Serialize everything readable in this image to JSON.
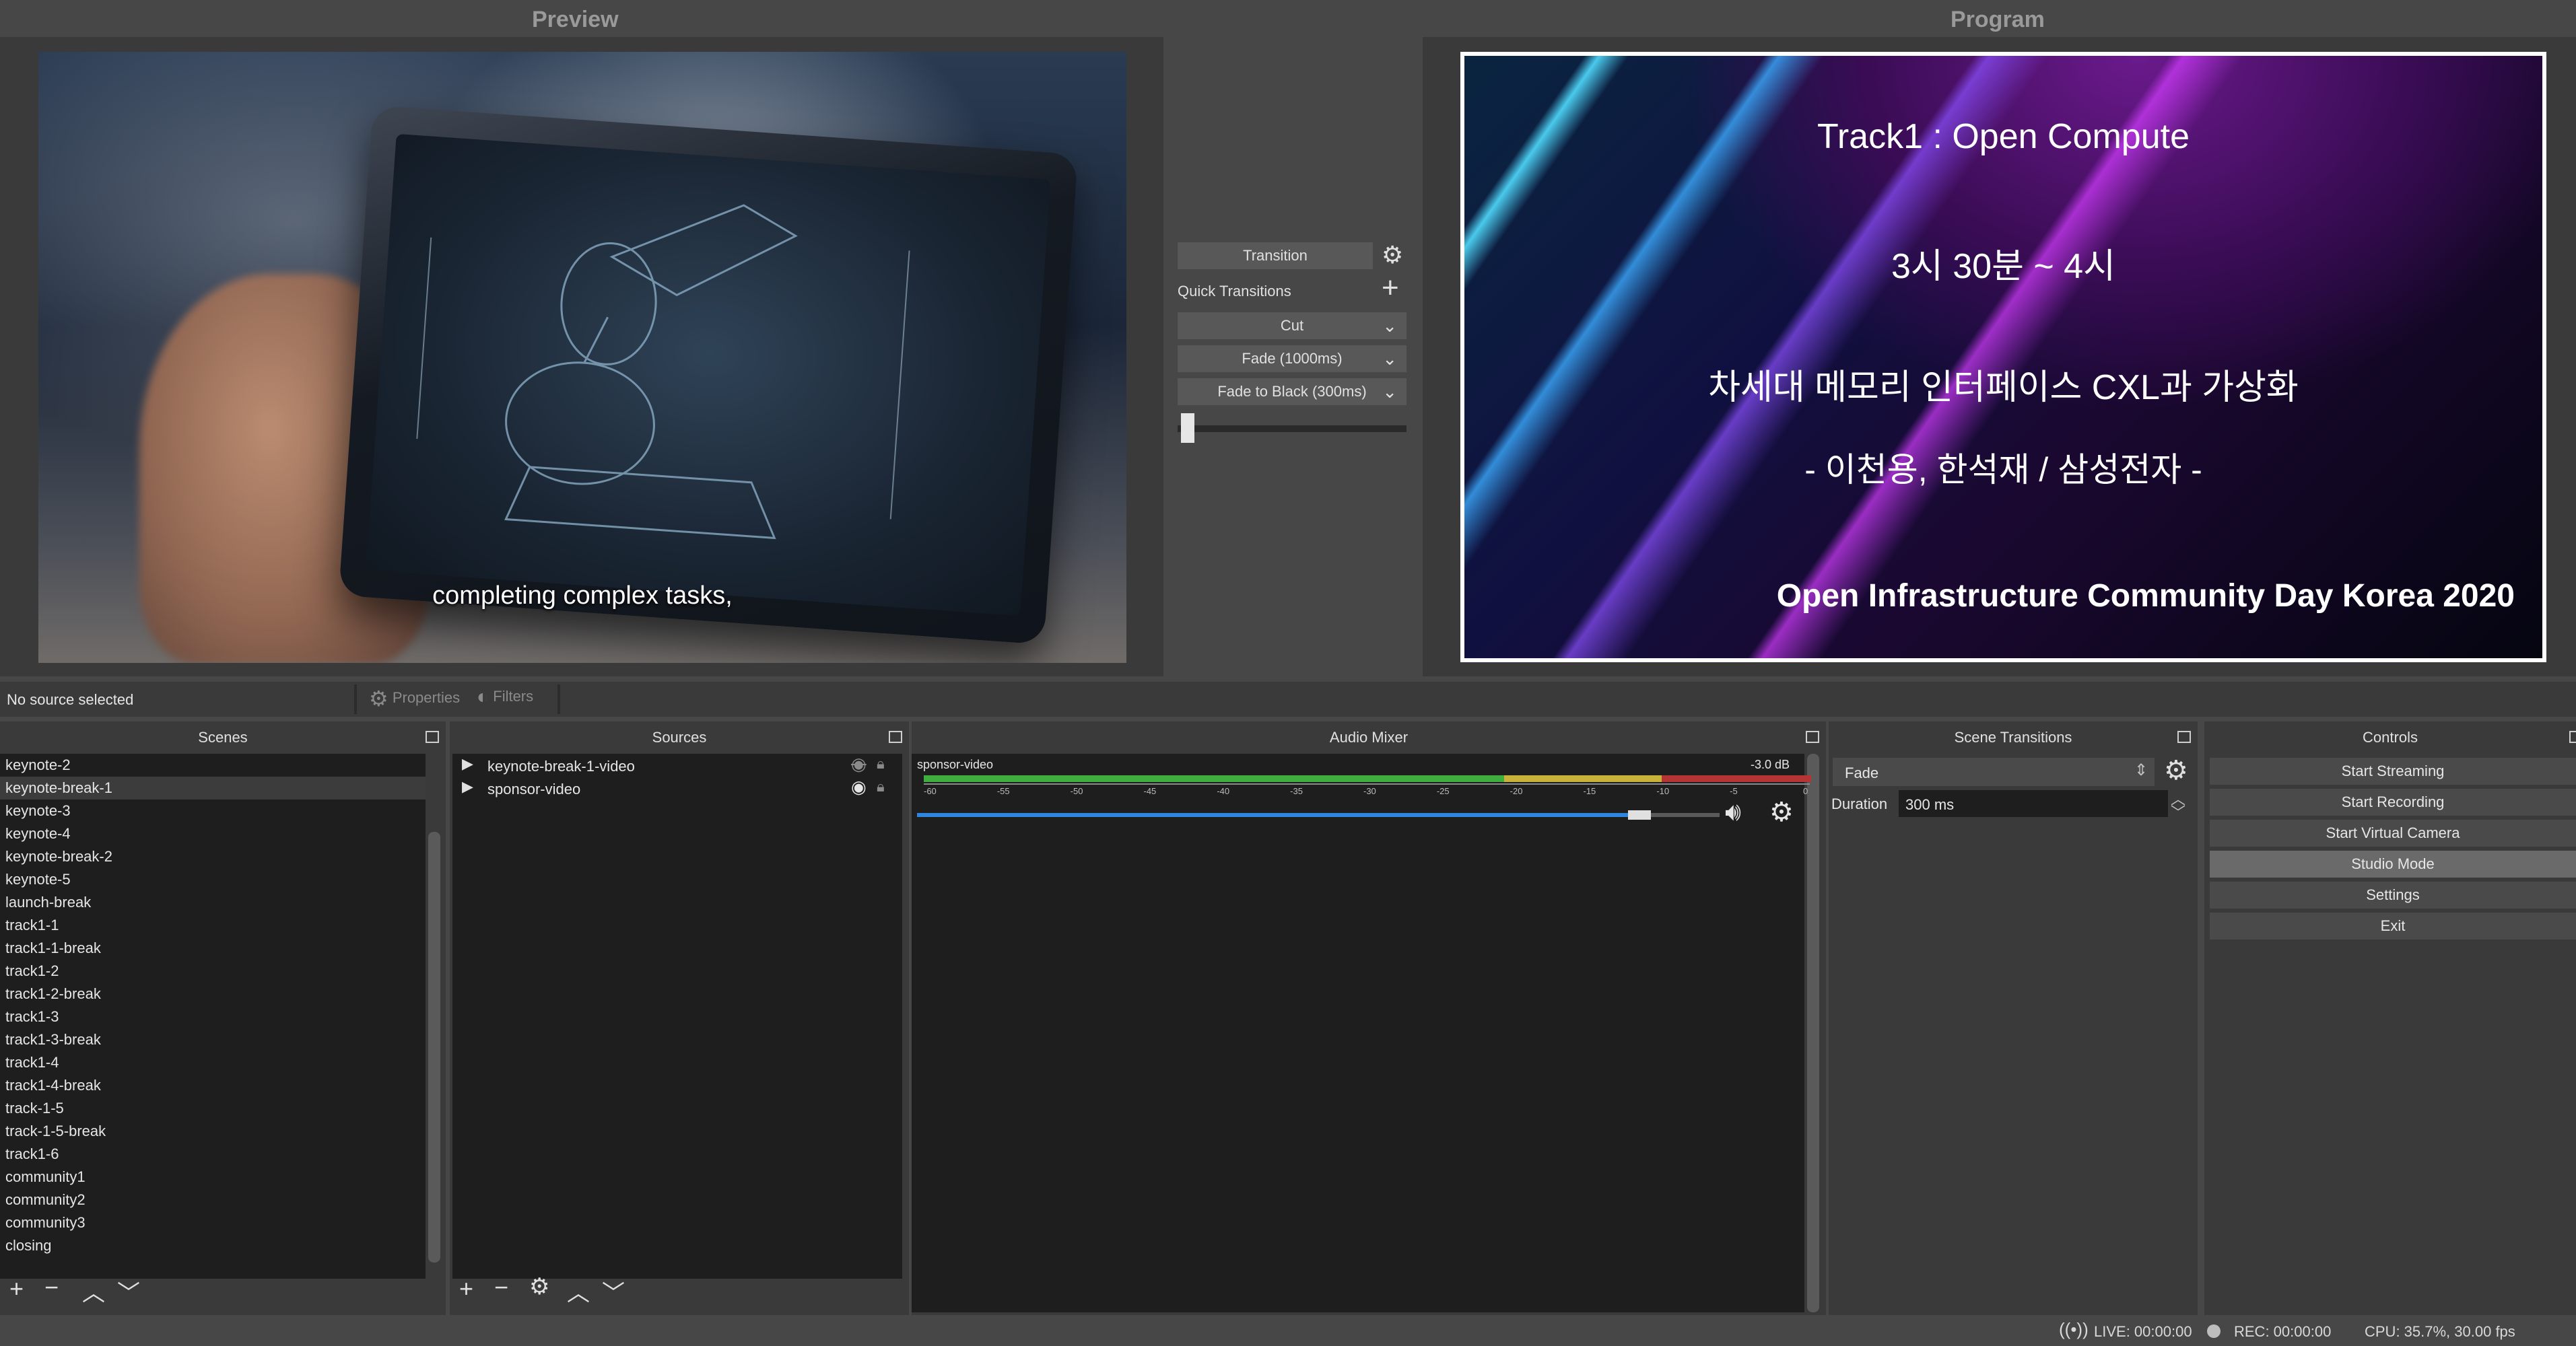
{
  "preview": {
    "title": "Preview",
    "caption": "completing complex tasks,"
  },
  "program": {
    "title": "Program",
    "line1": "Track1 : Open Compute",
    "line2": "3시 30분 ~ 4시",
    "line3": "차세대 메모리 인터페이스 CXL과 가상화",
    "line4": "- 이천용, 한석재 / 삼성전자 -",
    "line5": "Open Infrastructure Community Day Korea 2020"
  },
  "transition_panel": {
    "transition_label": "Transition",
    "quick_transitions_label": "Quick Transitions",
    "quick": [
      "Cut",
      "Fade (1000ms)",
      "Fade to Black (300ms)"
    ],
    "tbar_value": 0
  },
  "source_strip": {
    "status": "No source selected",
    "properties_label": "Properties",
    "filters_label": "Filters"
  },
  "scenes": {
    "title": "Scenes",
    "selected_index": 1,
    "items": [
      "keynote-2",
      "keynote-break-1",
      "keynote-3",
      "keynote-4",
      "keynote-break-2",
      "keynote-5",
      "launch-break",
      "track1-1",
      "track1-1-break",
      "track1-2",
      "track1-2-break",
      "track1-3",
      "track1-3-break",
      "track1-4",
      "track1-4-break",
      "track-1-5",
      "track-1-5-break",
      "track1-6",
      "community1",
      "community2",
      "community3",
      "closing"
    ]
  },
  "sources": {
    "title": "Sources",
    "items": [
      {
        "name": "keynote-break-1-video",
        "visible": false,
        "locked": true
      },
      {
        "name": "sponsor-video",
        "visible": true,
        "locked": true
      }
    ]
  },
  "audio_mixer": {
    "title": "Audio Mixer",
    "channels": [
      {
        "name": "sponsor-video",
        "level": "-3.0 dB",
        "volume_fraction": 0.9
      }
    ],
    "scale": [
      "-60",
      "-55",
      "-50",
      "-45",
      "-40",
      "-35",
      "-30",
      "-25",
      "-20",
      "-15",
      "-10",
      "-5",
      "0"
    ]
  },
  "scene_transitions": {
    "title": "Scene Transitions",
    "selected": "Fade",
    "duration_label": "Duration",
    "duration_value": "300 ms"
  },
  "controls": {
    "title": "Controls",
    "buttons": [
      "Start Streaming",
      "Start Recording",
      "Start Virtual Camera",
      "Studio Mode",
      "Settings",
      "Exit"
    ],
    "active_index": 3
  },
  "statusbar": {
    "live": "LIVE: 00:00:00",
    "rec": "REC: 00:00:00",
    "cpu": "CPU: 35.7%, 30.00 fps"
  },
  "colors": {
    "background": "#474747",
    "panel": "#3a3a3a",
    "list_background": "#1e1e1e",
    "meter_green": "#3fae3f",
    "meter_yellow": "#c7b33a",
    "meter_red": "#b53434",
    "volume_blue": "#2e86de"
  }
}
